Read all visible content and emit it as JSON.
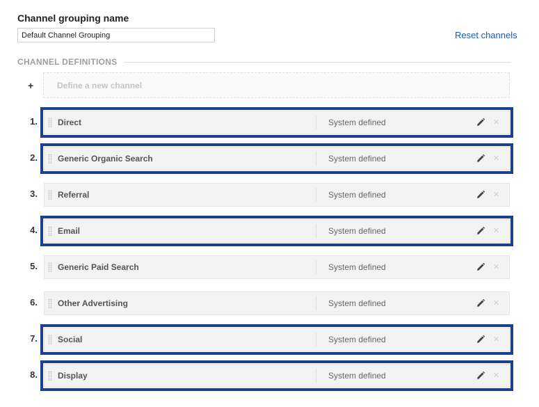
{
  "grouping": {
    "label": "Channel grouping name",
    "value": "Default Channel Grouping"
  },
  "reset_label": "Reset channels",
  "section_title": "CHANNEL DEFINITIONS",
  "new_channel": {
    "plus": "+",
    "label": "Define a new channel"
  },
  "channels": [
    {
      "num": "1.",
      "name": "Direct",
      "type": "System defined",
      "highlighted": true
    },
    {
      "num": "2.",
      "name": "Generic Organic Search",
      "type": "System defined",
      "highlighted": true
    },
    {
      "num": "3.",
      "name": "Referral",
      "type": "System defined",
      "highlighted": false
    },
    {
      "num": "4.",
      "name": "Email",
      "type": "System defined",
      "highlighted": true
    },
    {
      "num": "5.",
      "name": "Generic Paid Search",
      "type": "System defined",
      "highlighted": false
    },
    {
      "num": "6.",
      "name": "Other Advertising",
      "type": "System defined",
      "highlighted": false
    },
    {
      "num": "7.",
      "name": "Social",
      "type": "System defined",
      "highlighted": true
    },
    {
      "num": "8.",
      "name": "Display",
      "type": "System defined",
      "highlighted": true
    }
  ],
  "icons": {
    "edit": "pencil-icon",
    "delete": "close-icon",
    "drag": "drag-handle-icon"
  },
  "colors": {
    "highlight_border": "#1f3f8f",
    "link": "#1a5dab"
  }
}
